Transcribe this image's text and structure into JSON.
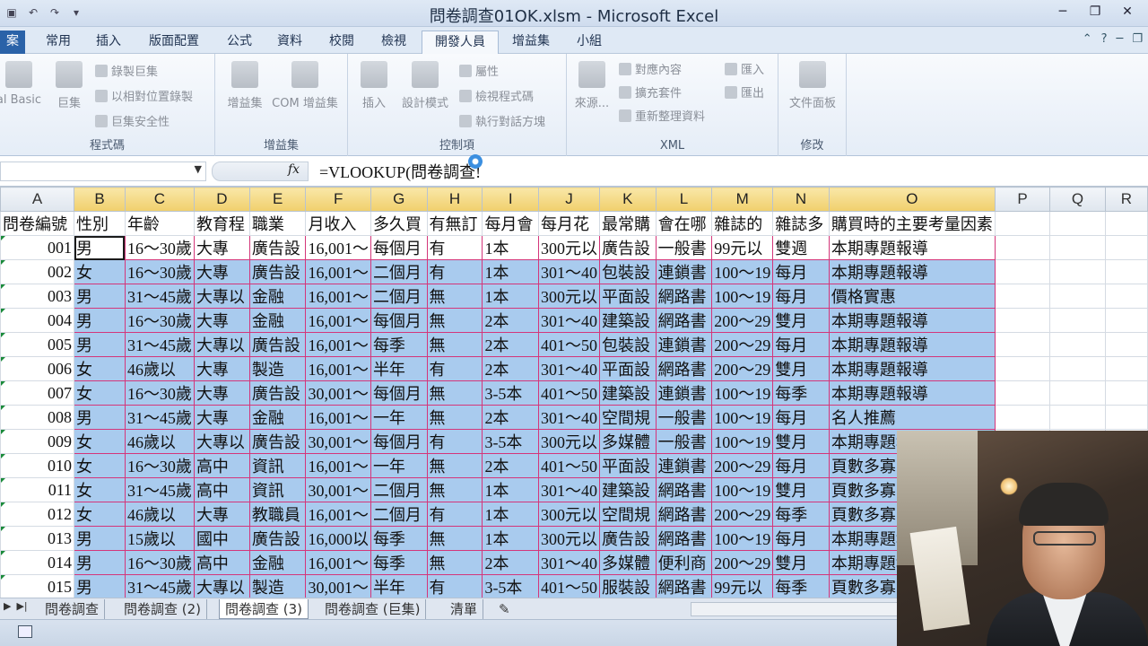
{
  "window": {
    "title": "問卷調查01OK.xlsm - Microsoft Excel"
  },
  "ribbon_tabs": [
    {
      "label": "案"
    },
    {
      "label": "常用"
    },
    {
      "label": "插入"
    },
    {
      "label": "版面配置"
    },
    {
      "label": "公式"
    },
    {
      "label": "資料"
    },
    {
      "label": "校閱"
    },
    {
      "label": "檢視"
    },
    {
      "label": "開發人員"
    },
    {
      "label": "增益集"
    },
    {
      "label": "小組"
    }
  ],
  "ribbon": {
    "code": {
      "label": "程式碼",
      "vb_label": "al Basic",
      "macros_label": "巨集",
      "record_macro": "錄製巨集",
      "relative_ref": "以相對位置錄製",
      "macro_security": "巨集安全性"
    },
    "addins": {
      "label": "增益集",
      "addins_label": "增益集",
      "com_label": "COM 增益集"
    },
    "controls": {
      "label": "控制項",
      "insert_label": "插入",
      "design_mode": "設計模式",
      "properties": "屬性",
      "view_code": "檢視程式碼",
      "run_dialog": "執行對話方塊"
    },
    "xml": {
      "label": "XML",
      "source": "來源...",
      "map_props": "對應內容",
      "expansion_packs": "擴充套件",
      "refresh_data": "重新整理資料",
      "import": "匯入",
      "export": "匯出"
    },
    "modify": {
      "label": "修改",
      "doc_panel": "文件面板"
    }
  },
  "formula_bar": {
    "fx": "fx",
    "formula": "=VLOOKUP(問卷調查!"
  },
  "columns": [
    "A",
    "B",
    "C",
    "D",
    "E",
    "F",
    "G",
    "H",
    "I",
    "J",
    "K",
    "L",
    "M",
    "N",
    "O",
    "P",
    "Q",
    "R"
  ],
  "header_row": [
    "問卷編號",
    "性別",
    "年齡",
    "教育程",
    "職業",
    "月收入",
    "多久買",
    "有無訂",
    "每月會",
    "每月花",
    "最常購",
    "會在哪",
    "雜誌的",
    "雜誌多",
    "購買時的主要考量因素",
    "",
    "",
    ""
  ],
  "rows": [
    [
      "001",
      "男",
      "16～30歲",
      "大專",
      "廣告設",
      "16,001～",
      "每個月",
      "有",
      "1本",
      "300元以",
      "廣告設",
      "一般書",
      "99元以",
      "雙週",
      "本期專題報導"
    ],
    [
      "002",
      "女",
      "16～30歲",
      "大專",
      "廣告設",
      "16,001～",
      "二個月",
      "有",
      "1本",
      "301～40",
      "包裝設",
      "連鎖書",
      "100～19",
      "每月",
      "本期專題報導"
    ],
    [
      "003",
      "男",
      "31～45歲",
      "大專以",
      "金融",
      "16,001～",
      "二個月",
      "無",
      "1本",
      "300元以",
      "平面設",
      "網路書",
      "100～19",
      "每月",
      "價格實惠"
    ],
    [
      "004",
      "男",
      "16～30歲",
      "大專",
      "金融",
      "16,001～",
      "每個月",
      "無",
      "2本",
      "301～40",
      "建築設",
      "網路書",
      "200～29",
      "雙月",
      "本期專題報導"
    ],
    [
      "005",
      "男",
      "31～45歲",
      "大專以",
      "廣告設",
      "16,001～",
      "每季",
      "無",
      "2本",
      "401～50",
      "包裝設",
      "連鎖書",
      "200～29",
      "每月",
      "本期專題報導"
    ],
    [
      "006",
      "女",
      "46歲以",
      "大專",
      "製造",
      "16,001～",
      "半年",
      "有",
      "2本",
      "301～40",
      "平面設",
      "網路書",
      "200～29",
      "雙月",
      "本期專題報導"
    ],
    [
      "007",
      "女",
      "16～30歲",
      "大專",
      "廣告設",
      "30,001～",
      "每個月",
      "無",
      "3-5本",
      "401～50",
      "建築設",
      "連鎖書",
      "100～19",
      "每季",
      "本期專題報導"
    ],
    [
      "008",
      "男",
      "31～45歲",
      "大專",
      "金融",
      "16,001～",
      "一年",
      "無",
      "2本",
      "301～40",
      "空間規",
      "一般書",
      "100～19",
      "每月",
      "名人推薦"
    ],
    [
      "009",
      "女",
      "46歲以",
      "大專以",
      "廣告設",
      "30,001～",
      "每個月",
      "有",
      "3-5本",
      "300元以",
      "多媒體",
      "一般書",
      "100～19",
      "雙月",
      "本期專題報導"
    ],
    [
      "010",
      "女",
      "16～30歲",
      "高中",
      "資訊",
      "16,001～",
      "一年",
      "無",
      "2本",
      "401～50",
      "平面設",
      "連鎖書",
      "200～29",
      "每月",
      "頁數多寡"
    ],
    [
      "011",
      "女",
      "31～45歲",
      "高中",
      "資訊",
      "30,001～",
      "二個月",
      "無",
      "1本",
      "301～40",
      "建築設",
      "網路書",
      "100～19",
      "雙月",
      "頁數多寡"
    ],
    [
      "012",
      "女",
      "46歲以",
      "大專",
      "教職員",
      "16,001～",
      "二個月",
      "有",
      "1本",
      "300元以",
      "空間規",
      "網路書",
      "200～29",
      "每季",
      "頁數多寡"
    ],
    [
      "013",
      "男",
      "15歲以",
      "國中",
      "廣告設",
      "16,000以",
      "每季",
      "無",
      "1本",
      "300元以",
      "廣告設",
      "網路書",
      "100～19",
      "每月",
      "本期專題報導"
    ],
    [
      "014",
      "男",
      "16～30歲",
      "高中",
      "金融",
      "16,001～",
      "每季",
      "無",
      "2本",
      "301～40",
      "多媒體",
      "便利商",
      "200～29",
      "雙月",
      "本期專題報導"
    ],
    [
      "015",
      "男",
      "31～45歲",
      "大專以",
      "製造",
      "30,001～",
      "半年",
      "有",
      "3-5本",
      "401～50",
      "服裝設",
      "網路書",
      "99元以",
      "每季",
      "頁數多寡"
    ]
  ],
  "sheet_tabs": [
    {
      "label": "問卷調查"
    },
    {
      "label": "問卷調查 (2)"
    },
    {
      "label": "問卷調查 (3)"
    },
    {
      "label": "問卷調查 (巨集)"
    },
    {
      "label": "清單"
    }
  ],
  "active_sheet_index": 2,
  "colors": {
    "selection_fill": "#a9cbee",
    "selection_border": "#d4367a",
    "header_highlight": "#f0cf6c"
  }
}
